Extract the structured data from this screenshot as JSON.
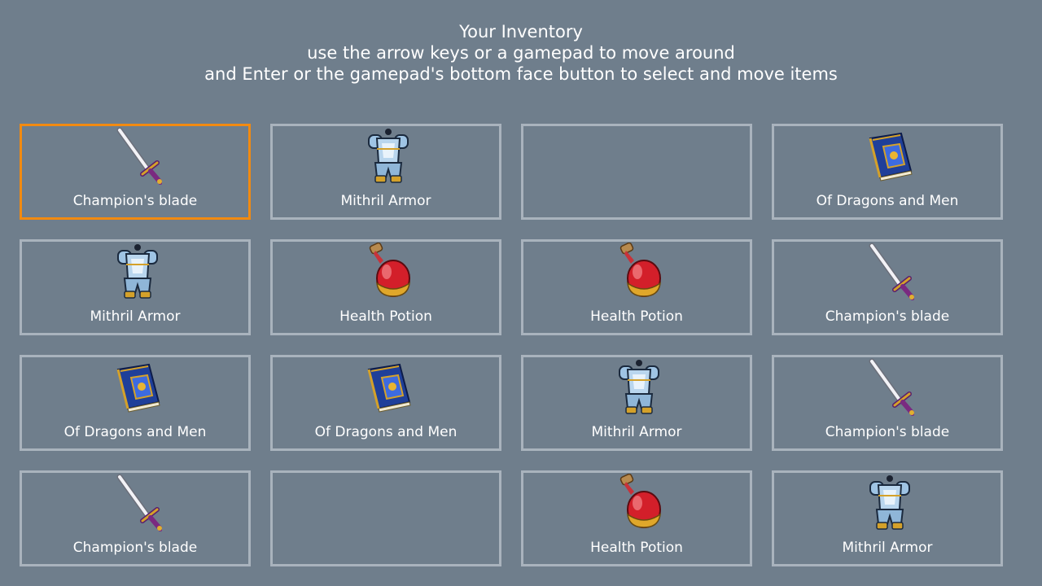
{
  "header": {
    "title": "Your Inventory",
    "line2": "use the arrow keys or a gamepad to move around",
    "line3": "and Enter or the gamepad's bottom face button to select and move items"
  },
  "colors": {
    "background": "#6f7e8c",
    "slot_border": "#a9b3bd",
    "selected_border": "#f28a10"
  },
  "inventory": {
    "columns": 4,
    "rows": 4,
    "selected_slot": 0,
    "slots": [
      {
        "label": "Champion's blade",
        "icon": "sword-icon"
      },
      {
        "label": "Mithril Armor",
        "icon": "armor-icon"
      },
      {
        "label": "",
        "icon": ""
      },
      {
        "label": "Of Dragons and Men",
        "icon": "book-icon"
      },
      {
        "label": "Mithril Armor",
        "icon": "armor-icon"
      },
      {
        "label": "Health Potion",
        "icon": "potion-icon"
      },
      {
        "label": "Health Potion",
        "icon": "potion-icon"
      },
      {
        "label": "Champion's blade",
        "icon": "sword-icon"
      },
      {
        "label": "Of Dragons and Men",
        "icon": "book-icon"
      },
      {
        "label": "Of Dragons and Men",
        "icon": "book-icon"
      },
      {
        "label": "Mithril Armor",
        "icon": "armor-icon"
      },
      {
        "label": "Champion's blade",
        "icon": "sword-icon"
      },
      {
        "label": "Champion's blade",
        "icon": "sword-icon"
      },
      {
        "label": "",
        "icon": ""
      },
      {
        "label": "Health Potion",
        "icon": "potion-icon"
      },
      {
        "label": "Mithril Armor",
        "icon": "armor-icon"
      }
    ]
  }
}
